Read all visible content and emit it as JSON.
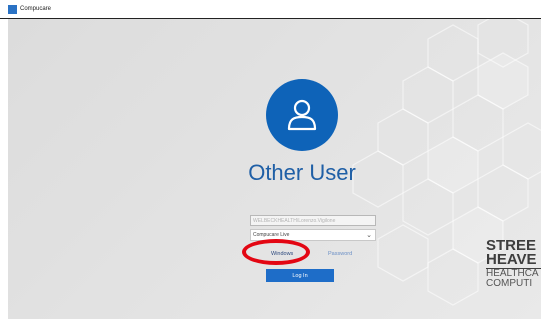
{
  "window": {
    "title": "Compucare"
  },
  "login": {
    "user_name": "Other User",
    "username_value": "WELBECKHEALTH\\Lorenzo.Vigilone",
    "domain_selected": "Compucare Live",
    "tabs": [
      {
        "label": "Windows"
      },
      {
        "label": "Password"
      }
    ],
    "login_button": "Log In"
  },
  "brand": {
    "line1": "STREE",
    "line2": "HEAVE",
    "line3": "HEALTHCA",
    "line4": "COMPUTI"
  },
  "colors": {
    "accent": "#0e63b8",
    "button": "#1e6dc8",
    "annotation": "#e30613"
  }
}
